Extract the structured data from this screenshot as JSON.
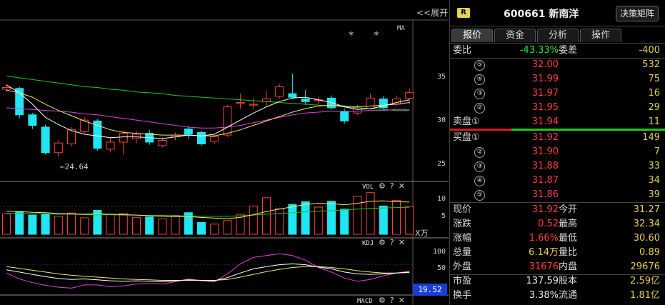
{
  "chart": {
    "expand_label": "<<展开",
    "ma_label": "MA",
    "stars": "* *",
    "low_note": "←24.64",
    "price_axis": [
      "35",
      "30",
      "25"
    ],
    "vol_label": "VOL",
    "vol_axis": [
      "10",
      "5"
    ],
    "vol_unit": "X万",
    "kdj_label": "KDJ",
    "kdj_axis": [
      "100",
      "50"
    ],
    "kdj_value": "19.52",
    "macd_label": "MACD",
    "tool_gear": "⚙",
    "tool_help": "?",
    "tool_close": "✕",
    "colors": {
      "up": "#ff3d3d",
      "down": "#1fe6f2",
      "ma_white": "#ffffff",
      "ma_yellow": "#f5e66a",
      "ma_magenta": "#e040e0",
      "ma_green": "#1ec81e"
    }
  },
  "chart_data": {
    "type": "candlestick",
    "price_range": [
      22,
      40
    ],
    "candles": [
      {
        "o": 32.3,
        "c": 32.5,
        "h": 32.9,
        "l": 32.0
      },
      {
        "o": 32.4,
        "c": 29.4,
        "h": 32.6,
        "l": 29.0
      },
      {
        "o": 29.4,
        "c": 28.2,
        "h": 29.6,
        "l": 27.8
      },
      {
        "o": 28.0,
        "c": 25.1,
        "h": 28.3,
        "l": 24.9
      },
      {
        "o": 25.1,
        "c": 26.2,
        "h": 26.5,
        "l": 24.64
      },
      {
        "o": 26.1,
        "c": 27.7,
        "h": 28.0,
        "l": 25.8
      },
      {
        "o": 27.5,
        "c": 28.8,
        "h": 29.1,
        "l": 27.3
      },
      {
        "o": 28.7,
        "c": 25.6,
        "h": 28.9,
        "l": 25.3
      },
      {
        "o": 25.5,
        "c": 26.3,
        "h": 26.8,
        "l": 25.2
      },
      {
        "o": 26.3,
        "c": 27.3,
        "h": 27.6,
        "l": 24.9
      },
      {
        "o": 26.7,
        "c": 27.2,
        "h": 27.6,
        "l": 26.2
      },
      {
        "o": 27.3,
        "c": 26.3,
        "h": 27.7,
        "l": 26.0
      },
      {
        "o": 25.9,
        "c": 26.5,
        "h": 26.8,
        "l": 25.7
      },
      {
        "o": 26.9,
        "c": 27.1,
        "h": 27.4,
        "l": 26.5
      },
      {
        "o": 27.8,
        "c": 27.2,
        "h": 28.1,
        "l": 26.7
      },
      {
        "o": 27.4,
        "c": 26.1,
        "h": 27.6,
        "l": 25.9
      },
      {
        "o": 26.4,
        "c": 26.9,
        "h": 27.2,
        "l": 26.1
      },
      {
        "o": 27.1,
        "c": 30.3,
        "h": 30.5,
        "l": 26.9
      },
      {
        "o": 30.7,
        "c": 30.8,
        "h": 31.8,
        "l": 30.1
      },
      {
        "o": 30.5,
        "c": 30.6,
        "h": 31.3,
        "l": 30.1
      },
      {
        "o": 30.9,
        "c": 31.2,
        "h": 32.1,
        "l": 30.4
      },
      {
        "o": 31.5,
        "c": 32.6,
        "h": 32.9,
        "l": 31.2
      },
      {
        "o": 31.8,
        "c": 31.4,
        "h": 34.1,
        "l": 31.2
      },
      {
        "o": 31.2,
        "c": 30.9,
        "h": 32.2,
        "l": 30.5
      },
      {
        "o": 31.0,
        "c": 31.1,
        "h": 31.4,
        "l": 30.6
      },
      {
        "o": 31.3,
        "c": 30.2,
        "h": 31.6,
        "l": 30.0
      },
      {
        "o": 29.8,
        "c": 28.7,
        "h": 30.1,
        "l": 28.4
      },
      {
        "o": 29.6,
        "c": 30.2,
        "h": 30.5,
        "l": 29.4
      },
      {
        "o": 30.1,
        "c": 31.3,
        "h": 31.8,
        "l": 30.0
      },
      {
        "o": 31.2,
        "c": 30.2,
        "h": 31.5,
        "l": 30.0
      },
      {
        "o": 30.6,
        "c": 31.2,
        "h": 31.6,
        "l": 30.4
      },
      {
        "o": 31.27,
        "c": 31.92,
        "h": 32.34,
        "l": 30.6
      }
    ],
    "ma_white": [
      32.8,
      31.9,
      30.6,
      29.1,
      28.3,
      27.6,
      27.2,
      27.0,
      26.8,
      26.9,
      26.9,
      26.8,
      26.7,
      26.9,
      27.1,
      27.0,
      27.2,
      28.0,
      28.8,
      29.6,
      30.3,
      30.9,
      31.3,
      31.4,
      31.1,
      30.8,
      30.3,
      30.0,
      30.1,
      30.4,
      30.8,
      31.1
    ],
    "ma_yellow": [
      32.2,
      31.9,
      31.4,
      30.6,
      29.9,
      29.3,
      28.7,
      28.2,
      27.7,
      27.4,
      27.3,
      27.2,
      27.1,
      27.1,
      27.1,
      27.0,
      27.0,
      27.3,
      27.7,
      28.2,
      28.7,
      29.2,
      29.7,
      30.1,
      30.4,
      30.5,
      30.4,
      30.3,
      30.4,
      30.5,
      30.6,
      30.8
    ],
    "ma_magenta": [
      30.2,
      30.1,
      30.0,
      29.9,
      29.8,
      29.7,
      29.5,
      29.4,
      29.2,
      29.0,
      28.8,
      28.6,
      28.4,
      28.2,
      28.0,
      27.9,
      27.9,
      28.0,
      28.2,
      28.5,
      28.8,
      29.1,
      29.4,
      29.6,
      29.7,
      29.8,
      29.8,
      29.8,
      29.9,
      29.9,
      30.0,
      30.0
    ],
    "ma_green": [
      33.8,
      33.6,
      33.4,
      33.2,
      33.0,
      32.8,
      32.6,
      32.5,
      32.3,
      32.2,
      32.0,
      31.9,
      31.8,
      31.6,
      31.5,
      31.4,
      31.3,
      31.2,
      31.1,
      31.0,
      30.9,
      30.8,
      30.7,
      30.6,
      30.5,
      30.4,
      30.3,
      30.2,
      30.1,
      30.0,
      29.9,
      29.9
    ],
    "vol_range": [
      0,
      12
    ],
    "volume": [
      5.2,
      5.8,
      4.9,
      5.1,
      4.6,
      5.4,
      4.2,
      6.1,
      5.0,
      5.3,
      4.3,
      4.4,
      3.9,
      4.8,
      5.5,
      3.0,
      2.6,
      3.5,
      5.1,
      7.2,
      9.3,
      6.5,
      7.6,
      8.3,
      6.9,
      8.4,
      6.4,
      9.7,
      10.6,
      7.2,
      8.6,
      7.1
    ],
    "vol_ma1": [
      5.9,
      5.8,
      5.6,
      5.5,
      5.3,
      5.2,
      5.1,
      5.2,
      5.1,
      5.0,
      4.9,
      4.7,
      4.6,
      4.5,
      4.5,
      4.3,
      4.1,
      4.0,
      4.3,
      5.0,
      5.8,
      6.4,
      7.0,
      7.6,
      7.9,
      7.8,
      7.5,
      7.9,
      8.4,
      8.5,
      8.3,
      8.2
    ],
    "vol_ma2": [
      5.3,
      5.3,
      5.2,
      5.2,
      5.1,
      5.1,
      5.0,
      5.0,
      5.0,
      4.9,
      4.9,
      4.8,
      4.8,
      4.7,
      4.7,
      4.6,
      4.6,
      4.6,
      4.7,
      4.9,
      5.1,
      5.3,
      5.5,
      5.7,
      5.9,
      6.0,
      6.2,
      6.4,
      6.6,
      6.7,
      6.8,
      6.9
    ],
    "kdj_range": [
      0,
      120
    ],
    "k": [
      55,
      50,
      45,
      40,
      36,
      34,
      35,
      33,
      31,
      30,
      31,
      30,
      29,
      31,
      33,
      32,
      31,
      38,
      48,
      57,
      62,
      66,
      68,
      66,
      61,
      57,
      50,
      46,
      45,
      46,
      48,
      50
    ],
    "d": [
      62,
      58,
      54,
      50,
      46,
      43,
      41,
      39,
      37,
      35,
      34,
      33,
      32,
      32,
      32,
      32,
      32,
      34,
      39,
      45,
      51,
      56,
      60,
      62,
      62,
      60,
      57,
      53,
      50,
      48,
      48,
      49
    ],
    "j": [
      48,
      35,
      27,
      21,
      17,
      15,
      22,
      22,
      18,
      20,
      24,
      25,
      24,
      29,
      35,
      31,
      29,
      46,
      68,
      82,
      86,
      90,
      86,
      76,
      60,
      50,
      37,
      30,
      34,
      42,
      48,
      52
    ]
  },
  "panel": {
    "badge": "R",
    "code": "600661",
    "name": "新南洋",
    "decision_button": "决策矩阵",
    "tabs": [
      "报价",
      "资金",
      "分析",
      "操作"
    ],
    "weibi_label": "委比",
    "weibi_value": "-43.33%",
    "weicha_label": "委差",
    "weicha_value": "-400",
    "sell": [
      {
        "level": "⑤",
        "price": "32.00",
        "vol": "532"
      },
      {
        "level": "④",
        "price": "31.99",
        "vol": "75"
      },
      {
        "level": "③",
        "price": "31.97",
        "vol": "16"
      },
      {
        "level": "②",
        "price": "31.95",
        "vol": "29"
      },
      {
        "level": "卖盘①",
        "price": "31.94",
        "vol": "11"
      }
    ],
    "buy": [
      {
        "level": "买盘①",
        "price": "31.92",
        "vol": "149"
      },
      {
        "level": "②",
        "price": "31.90",
        "vol": "7"
      },
      {
        "level": "③",
        "price": "31.88",
        "vol": "33"
      },
      {
        "level": "④",
        "price": "31.87",
        "vol": "34"
      },
      {
        "level": "⑤",
        "price": "31.86",
        "vol": "39"
      }
    ],
    "stats": [
      {
        "l1": "现价",
        "v1": "31.92",
        "c1": "red",
        "l2": "今开",
        "v2": "31.27",
        "c2": "green"
      },
      {
        "l1": "涨跌",
        "v1": "0.52",
        "c1": "red",
        "l2": "最高",
        "v2": "32.34",
        "c2": "red"
      },
      {
        "l1": "涨幅",
        "v1": "1.66%",
        "c1": "red",
        "l2": "最低",
        "v2": "30.60",
        "c2": "green"
      },
      {
        "l1": "总量",
        "v1": "6.14万",
        "c1": "yellow",
        "l2": "量比",
        "v2": "0.89",
        "c2": "white"
      },
      {
        "l1": "外盘",
        "v1": "31676",
        "c1": "red",
        "l2": "内盘",
        "v2": "29676",
        "c2": "green"
      },
      {
        "l1": "市盈",
        "v1": "137.59",
        "c1": "white",
        "l2": "股本",
        "v2": "2.59亿",
        "c2": "white"
      },
      {
        "l1": "换手",
        "v1": "3.38%",
        "c1": "white",
        "l2": "流通",
        "v2": "1.81亿",
        "c2": "white"
      }
    ]
  }
}
